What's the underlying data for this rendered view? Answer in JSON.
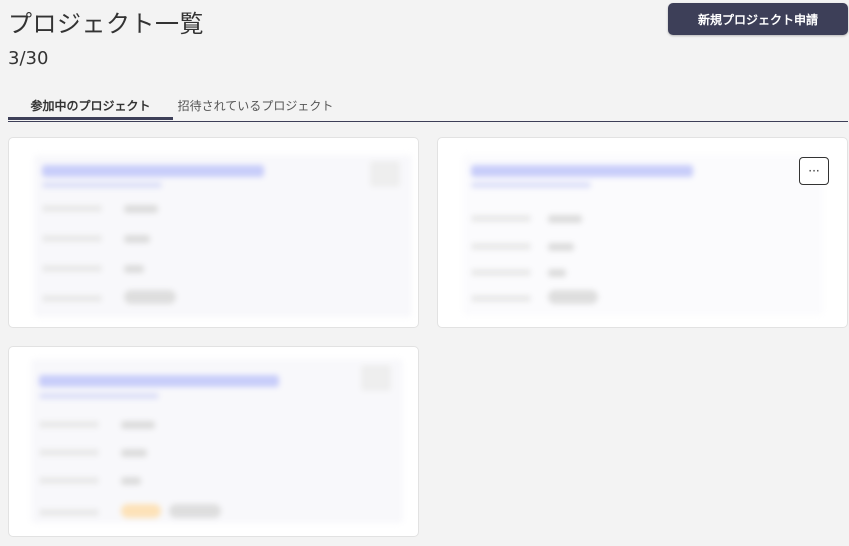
{
  "header": {
    "title": "プロジェクト一覧",
    "new_button_label": "新規プロジェクト申請",
    "count": "3/30"
  },
  "tabs": [
    {
      "label": "参加中のプロジェクト",
      "active": true
    },
    {
      "label": "招待されているプロジェクト",
      "active": false
    }
  ],
  "cards": [
    {
      "blurred": true
    },
    {
      "blurred": true,
      "more_label": "···",
      "more_icon": "ellipsis-icon"
    },
    {
      "blurred": true
    }
  ],
  "colors": {
    "primary": "#3d3f58",
    "background": "#f3f3f3",
    "card": "#ffffff",
    "blurred_link": "#c8cdfa",
    "chip_orange": "#fde2b8"
  }
}
